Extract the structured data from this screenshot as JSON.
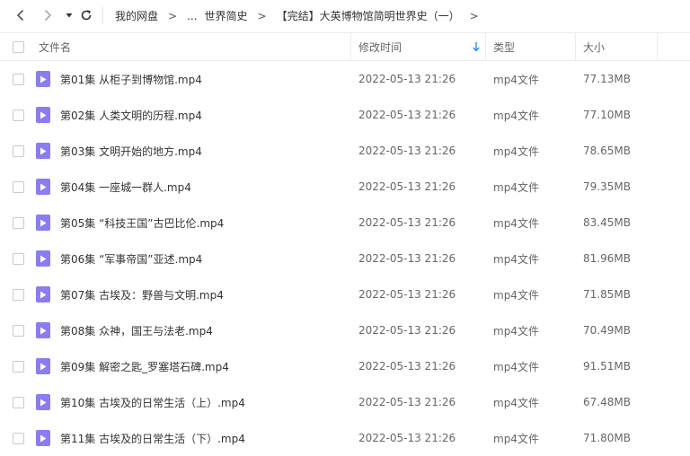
{
  "breadcrumb": {
    "items": [
      "我的网盘",
      "...",
      "世界简史",
      "【完结】大英博物馆简明世界史（一）"
    ],
    "separator": ">"
  },
  "columns": {
    "name": "文件名",
    "modified": "修改时间",
    "type": "类型",
    "size": "大小"
  },
  "colors": {
    "file_icon": "#8a7cf1",
    "sort_arrow": "#2b8cf7"
  },
  "files": [
    {
      "name": "第01集 从柜子到博物馆.mp4",
      "date": "2022-05-13 21:26",
      "type": "mp4文件",
      "size": "77.13MB"
    },
    {
      "name": "第02集 人类文明的历程.mp4",
      "date": "2022-05-13 21:26",
      "type": "mp4文件",
      "size": "77.10MB"
    },
    {
      "name": "第03集 文明开始的地方.mp4",
      "date": "2022-05-13 21:26",
      "type": "mp4文件",
      "size": "78.65MB"
    },
    {
      "name": "第04集 一座城一群人.mp4",
      "date": "2022-05-13 21:26",
      "type": "mp4文件",
      "size": "79.35MB"
    },
    {
      "name": "第05集 “科技王国”古巴比伦.mp4",
      "date": "2022-05-13 21:26",
      "type": "mp4文件",
      "size": "83.45MB"
    },
    {
      "name": "第06集 “军事帝国”亚述.mp4",
      "date": "2022-05-13 21:26",
      "type": "mp4文件",
      "size": "81.96MB"
    },
    {
      "name": "第07集 古埃及：野兽与文明.mp4",
      "date": "2022-05-13 21:26",
      "type": "mp4文件",
      "size": "71.85MB"
    },
    {
      "name": "第08集 众神，国王与法老.mp4",
      "date": "2022-05-13 21:26",
      "type": "mp4文件",
      "size": "70.49MB"
    },
    {
      "name": "第09集 解密之匙_罗塞塔石碑.mp4",
      "date": "2022-05-13 21:26",
      "type": "mp4文件",
      "size": "91.51MB"
    },
    {
      "name": "第10集 古埃及的日常生活（上）.mp4",
      "date": "2022-05-13 21:26",
      "type": "mp4文件",
      "size": "67.48MB"
    },
    {
      "name": "第11集 古埃及的日常生活（下）.mp4",
      "date": "2022-05-13 21:26",
      "type": "mp4文件",
      "size": "71.80MB"
    }
  ]
}
